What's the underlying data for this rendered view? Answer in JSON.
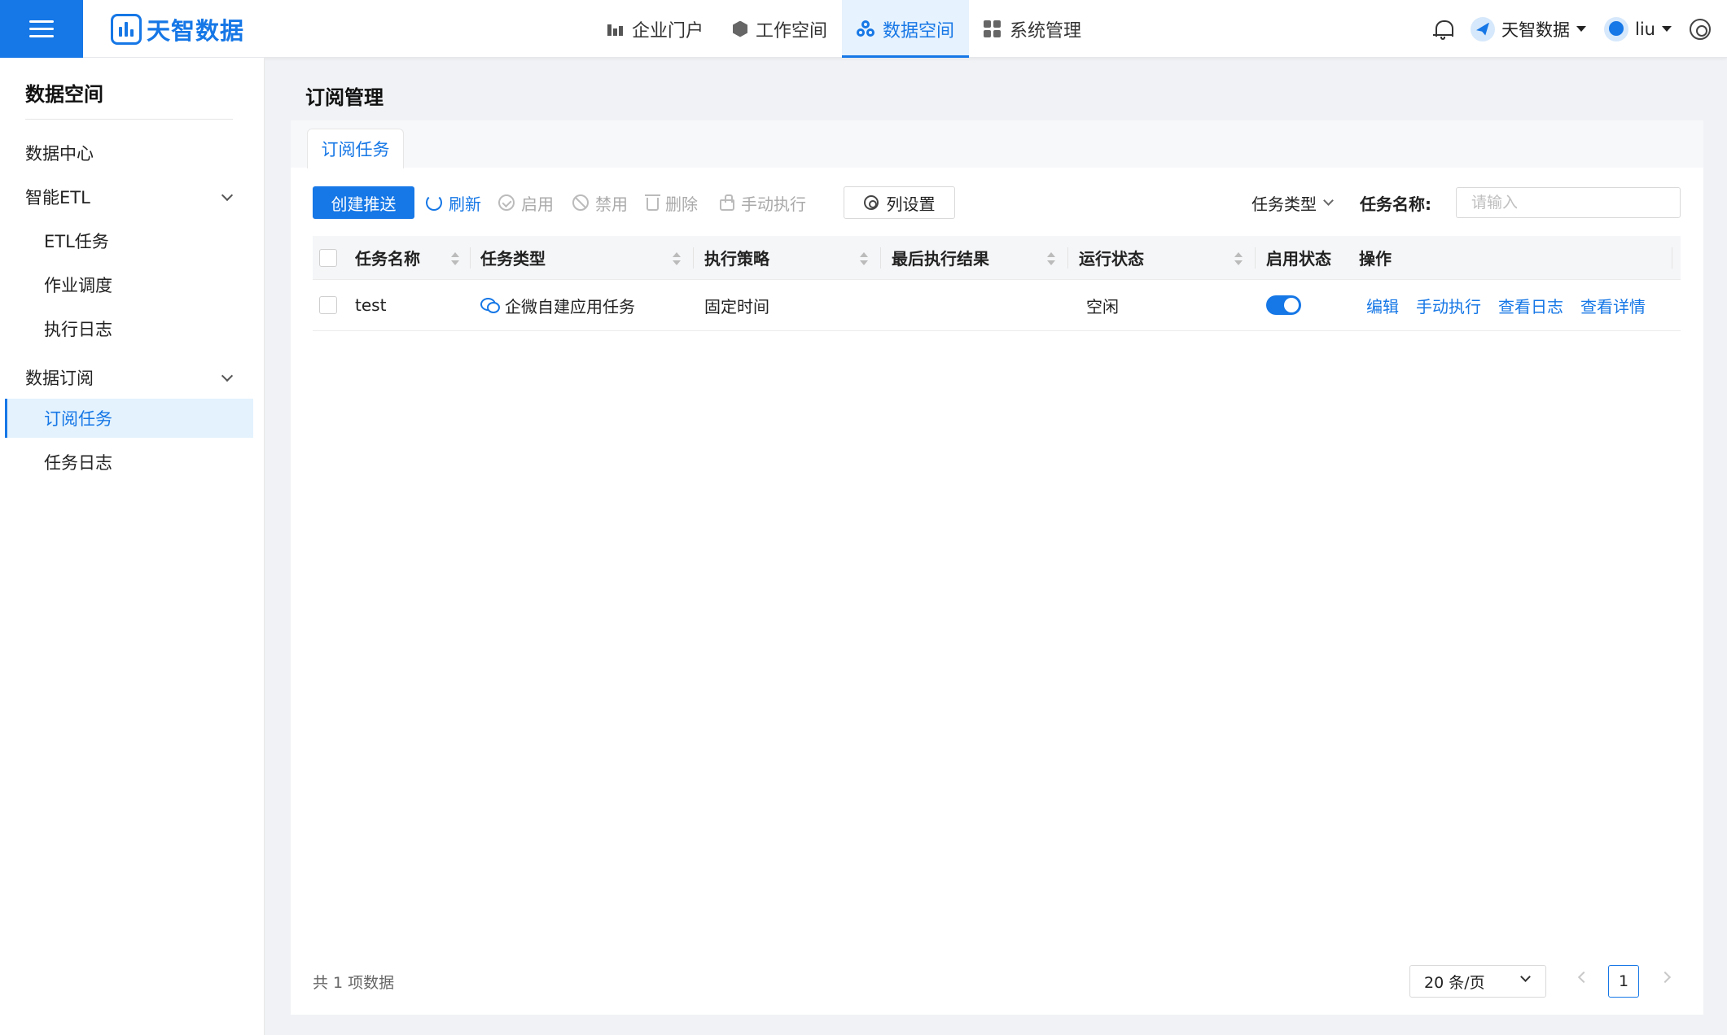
{
  "topbar": {
    "logo_text": "天智数据",
    "nav": [
      {
        "label": "企业门户",
        "icon": "chart-icon"
      },
      {
        "label": "工作空间",
        "icon": "cube-icon"
      },
      {
        "label": "数据空间",
        "icon": "cluster-icon",
        "active": true
      },
      {
        "label": "系统管理",
        "icon": "grid-icon"
      }
    ],
    "org_name": "天智数据",
    "user_name": "liu"
  },
  "sidebar": {
    "title": "数据空间",
    "items": [
      {
        "label": "数据中心",
        "level": 1
      },
      {
        "label": "智能ETL",
        "level": 1,
        "expanded": true
      },
      {
        "label": "ETL任务",
        "level": 2
      },
      {
        "label": "作业调度",
        "level": 2
      },
      {
        "label": "执行日志",
        "level": 2
      },
      {
        "label": "数据订阅",
        "level": 1,
        "expanded": true
      },
      {
        "label": "订阅任务",
        "level": 2,
        "active": true
      },
      {
        "label": "任务日志",
        "level": 2
      }
    ]
  },
  "main": {
    "page_title": "订阅管理",
    "tab_label": "订阅任务",
    "toolbar": {
      "create_label": "创建推送",
      "refresh_label": "刷新",
      "enable_label": "启用",
      "disable_label": "禁用",
      "delete_label": "删除",
      "manual_label": "手动执行",
      "columns_label": "列设置"
    },
    "filter": {
      "type_label": "任务类型",
      "name_label": "任务名称:",
      "name_placeholder": "请输入",
      "name_value": ""
    },
    "table": {
      "columns": [
        "任务名称",
        "任务类型",
        "执行策略",
        "最后执行结果",
        "运行状态",
        "启用状态",
        "操作"
      ],
      "rows": [
        {
          "name": "test",
          "type": "企微自建应用任务",
          "strategy": "固定时间",
          "last_result": "",
          "run_status": "空闲",
          "enabled": true,
          "actions": [
            "编辑",
            "手动执行",
            "查看日志",
            "查看详情"
          ]
        }
      ]
    },
    "footer": {
      "total_text": "共 1 项数据",
      "page_size": "20 条/页",
      "current_page": "1"
    }
  },
  "colors": {
    "primary": "#1677e6",
    "active_bg": "#e3f2fd",
    "page_bg": "#f0f2f5"
  }
}
